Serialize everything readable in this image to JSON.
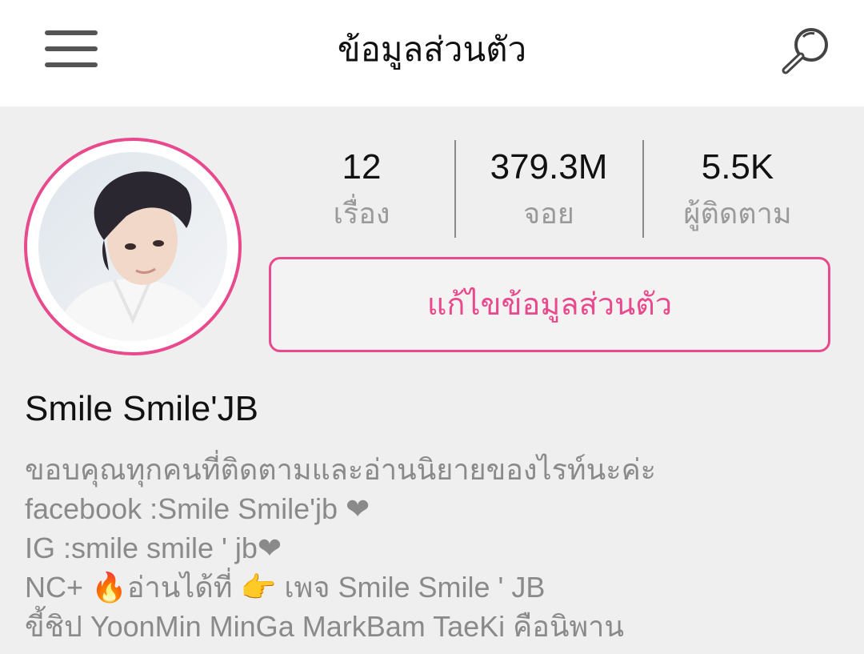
{
  "header": {
    "title": "ข้อมูลส่วนตัว",
    "menu_icon": "hamburger-menu-icon",
    "search_icon": "search-icon"
  },
  "profile": {
    "stats": [
      {
        "value": "12",
        "label": "เรื่อง"
      },
      {
        "value": "379.3M",
        "label": "จอย"
      },
      {
        "value": "5.5K",
        "label": "ผู้ติดตาม"
      }
    ],
    "edit_button_label": "แก้ไขข้อมูลส่วนตัว",
    "username": "Smile Smile'JB",
    "bio": [
      {
        "text": "ขอบคุณทุกคนที่ติดตามและอ่านนิยายของไรท์นะค่ะ"
      },
      {
        "text": "facebook :Smile Smile'jb ",
        "suffix": "❤"
      },
      {
        "text": "IG :smile smile ' jb",
        "suffix": "❤"
      },
      {
        "prefix": "NC+ ",
        "emoji1": "🔥",
        "middle": "อ่านได้ที่ ",
        "emoji2": "👉",
        "text": " เพจ Smile Smile ' JB"
      },
      {
        "text": "ขี้ชิป YoonMin MinGa MarkBam TaeKi คือนิพาน"
      }
    ]
  },
  "colors": {
    "accent": "#e84a8d",
    "background": "#efefef",
    "header_bg": "#ffffff",
    "muted_text": "#8a8a8a"
  }
}
